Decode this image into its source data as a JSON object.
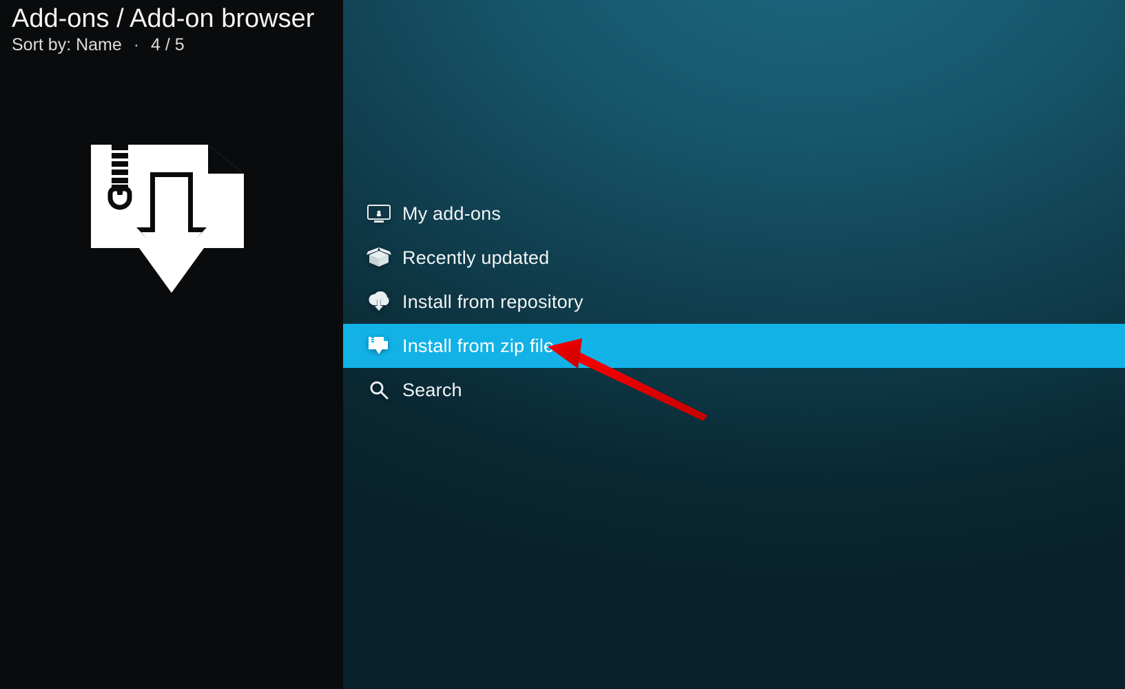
{
  "header": {
    "breadcrumb": "Add-ons / Add-on browser",
    "sort_label": "Sort by: Name",
    "position": "4 / 5"
  },
  "menu": {
    "items": [
      {
        "label": "My add-ons",
        "icon": "monitor-icon",
        "selected": false
      },
      {
        "label": "Recently updated",
        "icon": "open-box-icon",
        "selected": false
      },
      {
        "label": "Install from repository",
        "icon": "cloud-download-icon",
        "selected": false
      },
      {
        "label": "Install from zip file",
        "icon": "zip-file-download-icon",
        "selected": true
      },
      {
        "label": "Search",
        "icon": "search-icon",
        "selected": false
      }
    ]
  },
  "annotation": {
    "target_item_index": 3,
    "style": "red-arrow"
  },
  "colors": {
    "selection": "#12b2e7",
    "bg_side": "#0a0b0c",
    "arrow": "#ff0000"
  }
}
